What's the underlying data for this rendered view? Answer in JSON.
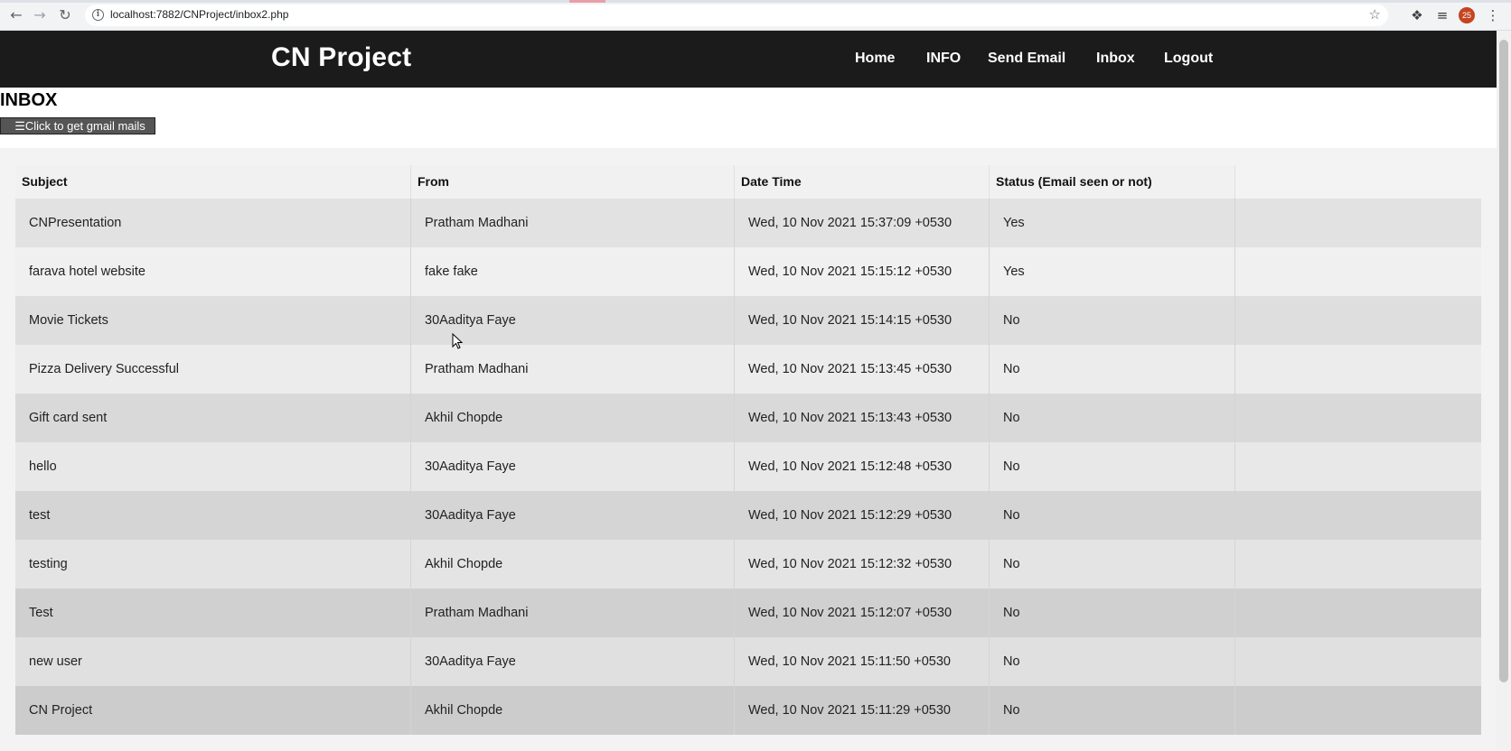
{
  "browser": {
    "url": "localhost:7882/CNProject/inbox2.php",
    "profile_badge": "25"
  },
  "header": {
    "brand": "CN Project",
    "nav": [
      "Home",
      "INFO",
      "Send Email",
      "Inbox",
      "Logout"
    ]
  },
  "page": {
    "title": "INBOX",
    "button_icon": "hamburger-icon",
    "button_label": "☰Click to get gmail mails"
  },
  "table": {
    "headers": [
      "Subject",
      "From",
      "Date Time",
      "Status (Email seen or not)"
    ],
    "rows": [
      {
        "subject": "CNPresentation",
        "from": "Pratham Madhani",
        "datetime": "Wed, 10 Nov 2021 15:37:09 +0530",
        "status": "Yes"
      },
      {
        "subject": "farava hotel website",
        "from": "fake fake",
        "datetime": "Wed, 10 Nov 2021 15:15:12 +0530",
        "status": "Yes"
      },
      {
        "subject": "Movie Tickets",
        "from": "30Aaditya Faye",
        "datetime": "Wed, 10 Nov 2021 15:14:15 +0530",
        "status": "No"
      },
      {
        "subject": "Pizza Delivery Successful",
        "from": "Pratham Madhani",
        "datetime": "Wed, 10 Nov 2021 15:13:45 +0530",
        "status": "No"
      },
      {
        "subject": "Gift card sent",
        "from": "Akhil Chopde",
        "datetime": "Wed, 10 Nov 2021 15:13:43 +0530",
        "status": "No"
      },
      {
        "subject": "hello",
        "from": "30Aaditya Faye",
        "datetime": "Wed, 10 Nov 2021 15:12:48 +0530",
        "status": "No"
      },
      {
        "subject": "test",
        "from": "30Aaditya Faye",
        "datetime": "Wed, 10 Nov 2021 15:12:29 +0530",
        "status": "No"
      },
      {
        "subject": "testing",
        "from": "Akhil Chopde",
        "datetime": "Wed, 10 Nov 2021 15:12:32 +0530",
        "status": "No"
      },
      {
        "subject": "Test",
        "from": "Pratham Madhani",
        "datetime": "Wed, 10 Nov 2021 15:12:07 +0530",
        "status": "No"
      },
      {
        "subject": "new user",
        "from": "30Aaditya Faye",
        "datetime": "Wed, 10 Nov 2021 15:11:50 +0530",
        "status": "No"
      },
      {
        "subject": "CN Project",
        "from": "Akhil Chopde",
        "datetime": "Wed, 10 Nov 2021 15:11:29 +0530",
        "status": "No"
      }
    ]
  },
  "colors": {
    "header_bg": "#1b1b1b",
    "row_dark": "#dedede",
    "row_light": "#f0f0f0",
    "button_bg": "#555555"
  },
  "icons": {
    "back": "back-arrow-icon",
    "forward": "forward-arrow-icon",
    "reload": "reload-icon",
    "info": "info-icon",
    "bookmark": "star-icon",
    "extensions": "puzzle-icon",
    "media": "playlist-icon",
    "menu": "kebab-menu-icon"
  }
}
